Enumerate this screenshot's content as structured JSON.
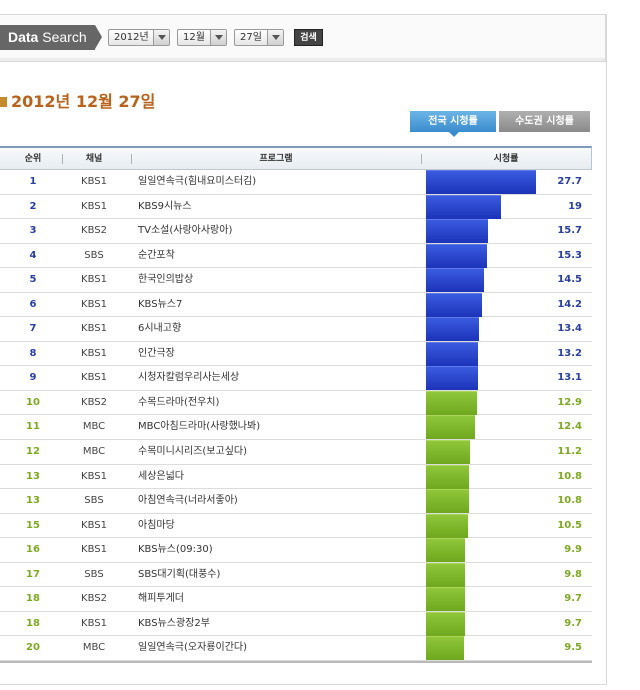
{
  "search": {
    "label_bold": "Data",
    "label_rest": " Search",
    "year": "2012년",
    "month": "12월",
    "day": "27일",
    "button": "검색"
  },
  "date_heading": "2012년 12월 27일",
  "tabs": {
    "national": "전국 시청률",
    "capital": "수도권 시청률"
  },
  "table": {
    "headers": {
      "rank": "순위",
      "channel": "채널",
      "program": "프로그램",
      "rating": "시청률"
    },
    "max_rating": 27.7,
    "rows": [
      {
        "rank": "1",
        "channel": "KBS1",
        "program": "일일연속극(힘내요미스터김)",
        "rating": "27.7",
        "value": 27.7,
        "color": "blue"
      },
      {
        "rank": "2",
        "channel": "KBS1",
        "program": "KBS9시뉴스",
        "rating": "19",
        "value": 19,
        "color": "blue"
      },
      {
        "rank": "3",
        "channel": "KBS2",
        "program": "TV소설(사랑아사랑아)",
        "rating": "15.7",
        "value": 15.7,
        "color": "blue"
      },
      {
        "rank": "4",
        "channel": "SBS",
        "program": "순간포착",
        "rating": "15.3",
        "value": 15.3,
        "color": "blue"
      },
      {
        "rank": "5",
        "channel": "KBS1",
        "program": "한국인의밥상",
        "rating": "14.5",
        "value": 14.5,
        "color": "blue"
      },
      {
        "rank": "6",
        "channel": "KBS1",
        "program": "KBS뉴스7",
        "rating": "14.2",
        "value": 14.2,
        "color": "blue"
      },
      {
        "rank": "7",
        "channel": "KBS1",
        "program": "6시내고향",
        "rating": "13.4",
        "value": 13.4,
        "color": "blue"
      },
      {
        "rank": "8",
        "channel": "KBS1",
        "program": "인간극장",
        "rating": "13.2",
        "value": 13.2,
        "color": "blue"
      },
      {
        "rank": "9",
        "channel": "KBS1",
        "program": "시청자칼럼우리사는세상",
        "rating": "13.1",
        "value": 13.1,
        "color": "blue"
      },
      {
        "rank": "10",
        "channel": "KBS2",
        "program": "수목드라마(전우치)",
        "rating": "12.9",
        "value": 12.9,
        "color": "green"
      },
      {
        "rank": "11",
        "channel": "MBC",
        "program": "MBC아침드라마(사랑했나봐)",
        "rating": "12.4",
        "value": 12.4,
        "color": "green"
      },
      {
        "rank": "12",
        "channel": "MBC",
        "program": "수목미니시리즈(보고싶다)",
        "rating": "11.2",
        "value": 11.2,
        "color": "green"
      },
      {
        "rank": "13",
        "channel": "KBS1",
        "program": "세상은넓다",
        "rating": "10.8",
        "value": 10.8,
        "color": "green"
      },
      {
        "rank": "13",
        "channel": "SBS",
        "program": "아침연속극(너라서좋아)",
        "rating": "10.8",
        "value": 10.8,
        "color": "green"
      },
      {
        "rank": "15",
        "channel": "KBS1",
        "program": "아침마당",
        "rating": "10.5",
        "value": 10.5,
        "color": "green"
      },
      {
        "rank": "16",
        "channel": "KBS1",
        "program": "KBS뉴스(09:30)",
        "rating": "9.9",
        "value": 9.9,
        "color": "green"
      },
      {
        "rank": "17",
        "channel": "SBS",
        "program": "SBS대기획(대풍수)",
        "rating": "9.8",
        "value": 9.8,
        "color": "green"
      },
      {
        "rank": "18",
        "channel": "KBS2",
        "program": "해피투게더",
        "rating": "9.7",
        "value": 9.7,
        "color": "green"
      },
      {
        "rank": "18",
        "channel": "KBS1",
        "program": "KBS뉴스광장2부",
        "rating": "9.7",
        "value": 9.7,
        "color": "green"
      },
      {
        "rank": "20",
        "channel": "MBC",
        "program": "일일연속극(오자룡이간다)",
        "rating": "9.5",
        "value": 9.5,
        "color": "green"
      }
    ]
  }
}
